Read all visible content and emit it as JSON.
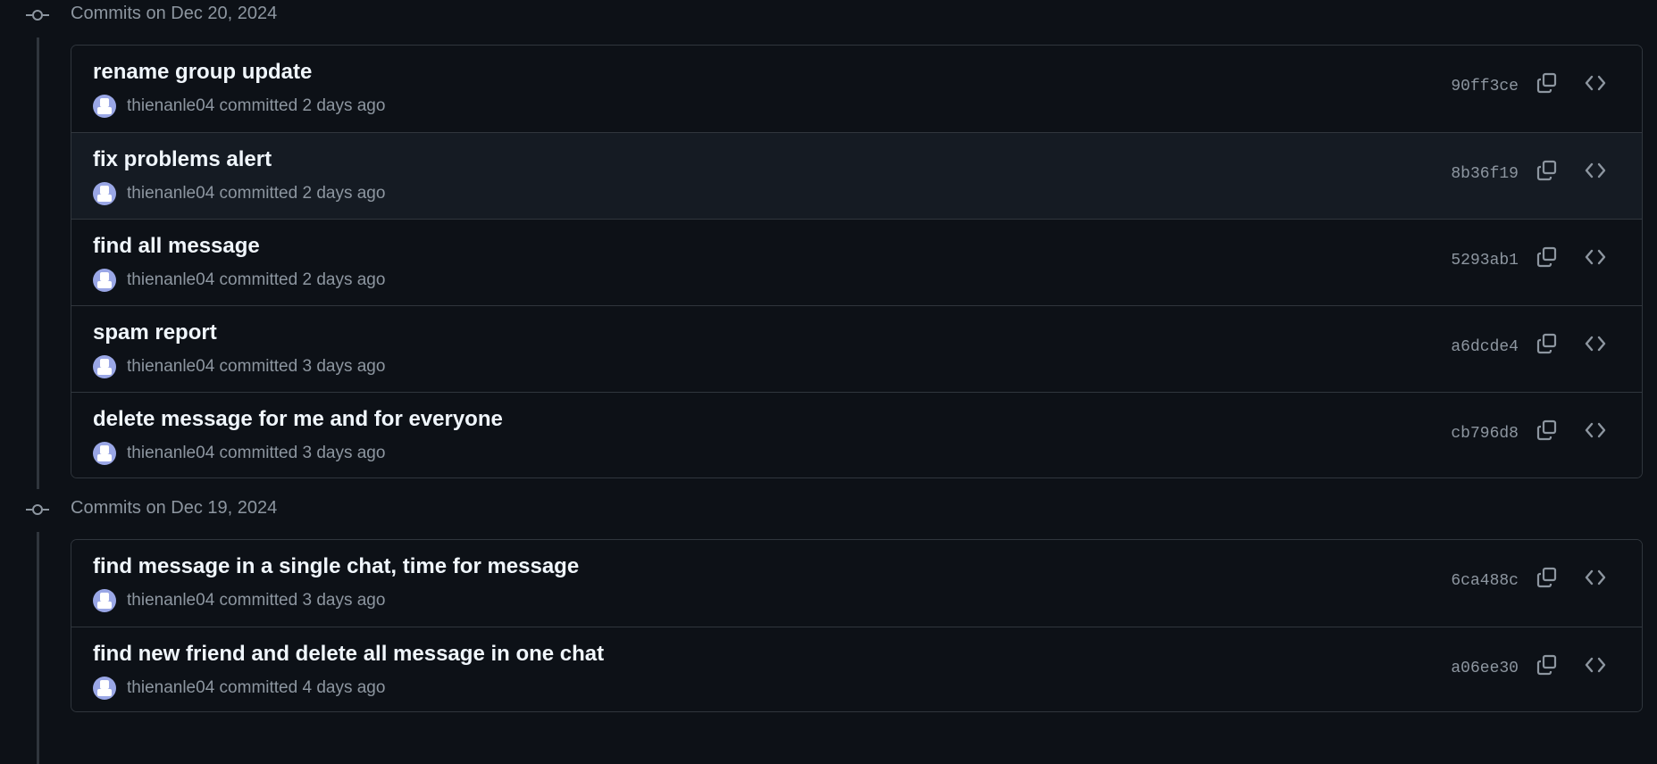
{
  "groups": [
    {
      "title": "Commits on Dec 20, 2024",
      "commits": [
        {
          "message": "rename group update",
          "author": "thienanle04",
          "verb": "committed",
          "time": "2 days ago",
          "sha": "90ff3ce"
        },
        {
          "message": "fix problems alert",
          "author": "thienanle04",
          "verb": "committed",
          "time": "2 days ago",
          "sha": "8b36f19"
        },
        {
          "message": "find all message",
          "author": "thienanle04",
          "verb": "committed",
          "time": "2 days ago",
          "sha": "5293ab1"
        },
        {
          "message": "spam report",
          "author": "thienanle04",
          "verb": "committed",
          "time": "3 days ago",
          "sha": "a6dcde4"
        },
        {
          "message": "delete message for me and for everyone",
          "author": "thienanle04",
          "verb": "committed",
          "time": "3 days ago",
          "sha": "cb796d8"
        }
      ]
    },
    {
      "title": "Commits on Dec 19, 2024",
      "commits": [
        {
          "message": "find message in a single chat, time for message",
          "author": "thienanle04",
          "verb": "committed",
          "time": "3 days ago",
          "sha": "6ca488c"
        },
        {
          "message": "find new friend and delete all message in one chat",
          "author": "thienanle04",
          "verb": "committed",
          "time": "4 days ago",
          "sha": "a06ee30"
        }
      ]
    }
  ],
  "icons": {
    "group_marker": "git-commit-icon",
    "copy": "copy-icon",
    "browse": "code-icon"
  },
  "colors": {
    "background": "#0d1117",
    "hover_row": "#151b23",
    "border": "#30363d",
    "muted_text": "#8d96a0",
    "primary_text": "#f0f6fc"
  }
}
